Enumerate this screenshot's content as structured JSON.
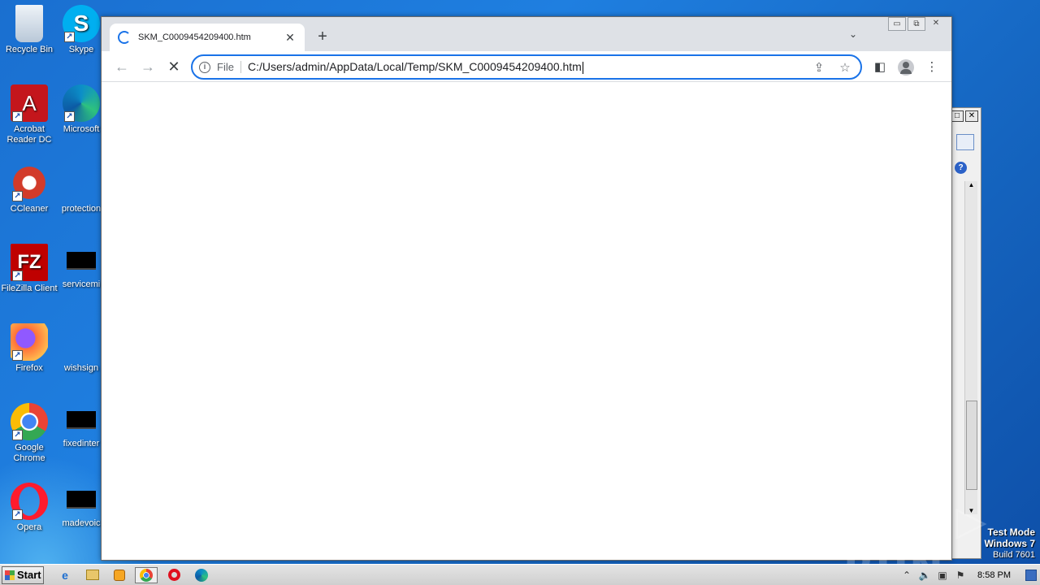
{
  "desktop": {
    "icons": [
      {
        "label": "Recycle Bin",
        "glyph": "🗑",
        "color": "#d8e4f0"
      },
      {
        "label": "Skype",
        "glyph": "S",
        "color": "#00aff0"
      },
      {
        "label": "Acrobat Reader DC",
        "glyph": "A",
        "color": "#c4161c"
      },
      {
        "label": "Microsoft",
        "glyph": "e",
        "color": "#0c8ec8"
      },
      {
        "label": "CCleaner",
        "glyph": "C",
        "color": "#d23b2a"
      },
      {
        "label": "protection",
        "glyph": "",
        "color": ""
      },
      {
        "label": "FileZilla Client",
        "glyph": "FZ",
        "color": "#bf0000"
      },
      {
        "label": "servicemi",
        "glyph": "",
        "color": "#000000"
      },
      {
        "label": "Firefox",
        "glyph": "🦊",
        "color": "#ff7139"
      },
      {
        "label": "wishsign",
        "glyph": "",
        "color": ""
      },
      {
        "label": "Google Chrome",
        "glyph": "●",
        "color": "#4285f4"
      },
      {
        "label": "fixedinter",
        "glyph": "",
        "color": "#000000"
      },
      {
        "label": "Opera",
        "glyph": "O",
        "color": "#ff1b2d"
      },
      {
        "label": "madevoic",
        "glyph": "",
        "color": "#000000"
      }
    ]
  },
  "browser": {
    "tab_title": "SKM_C0009454209400.htm",
    "tab_close": "✕",
    "new_tab": "+",
    "tab_search": "⌄",
    "window_controls": {
      "minimize": "▭",
      "restore": "⧉",
      "close": "✕"
    },
    "nav": {
      "back": "←",
      "forward": "→",
      "stop": "✕"
    },
    "omnibox": {
      "scheme_label": "File",
      "url": "C:/Users/admin/AppData/Local/Temp/SKM_C0009454209400.htm"
    }
  },
  "watermark": "ANY ▷ RUN",
  "test_mode": {
    "line1": "Test Mode",
    "line2": "Windows 7",
    "line3": "Build 7601"
  },
  "taskbar": {
    "start_label": "Start",
    "clock": "8:58 PM"
  },
  "colors": {
    "accent": "#1a73e8",
    "desktop": "#1f7fe0",
    "tabstrip": "#dee1e6"
  }
}
